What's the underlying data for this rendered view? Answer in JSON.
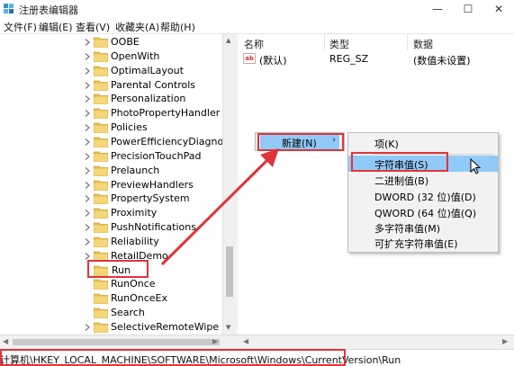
{
  "window": {
    "title": "注册表编辑器",
    "controls": {
      "minimize": "—",
      "maximize": "☐",
      "close": "✕"
    }
  },
  "menu": {
    "items": [
      "文件(F)",
      "编辑(E)",
      "查看(V)",
      "收藏夹(A)",
      "帮助(H)"
    ]
  },
  "tree": {
    "items": [
      "OOBE",
      "OpenWith",
      "OptimalLayout",
      "Parental Controls",
      "Personalization",
      "PhotoPropertyHandler",
      "Policies",
      "PowerEfficiencyDiagnostics",
      "PrecisionTouchPad",
      "Prelaunch",
      "PreviewHandlers",
      "PropertySystem",
      "Proximity",
      "PushNotifications",
      "Reliability",
      "RetailDemo",
      "Run",
      "RunOnce",
      "RunOnceEx",
      "Search",
      "SelectiveRemoteWipe"
    ],
    "selected": "Run"
  },
  "list": {
    "columns": [
      "名称",
      "类型",
      "数据"
    ],
    "rows": [
      {
        "name": "(默认)",
        "type": "REG_SZ",
        "data": "(数值未设置)",
        "icon": "string-value-icon"
      }
    ]
  },
  "context_menu": {
    "new_label": "新建(N)",
    "new_arrow": "›",
    "submenu": [
      "项(K)",
      "字符串值(S)",
      "二进制值(B)",
      "DWORD (32 位)值(D)",
      "QWORD (64 位)值(Q)",
      "多字符串值(M)",
      "可扩充字符串值(E)"
    ],
    "highlighted": "字符串值(S)"
  },
  "statusbar": {
    "path": "计算机\\HKEY_LOCAL_MACHINE\\SOFTWARE\\Microsoft\\Windows\\CurrentVersion\\Run"
  },
  "annotation": {
    "color": "#e0343a"
  },
  "colors": {
    "highlight": "#91c9f7",
    "menu_bg": "#f2f2f2",
    "folder": "#e8c04d"
  }
}
